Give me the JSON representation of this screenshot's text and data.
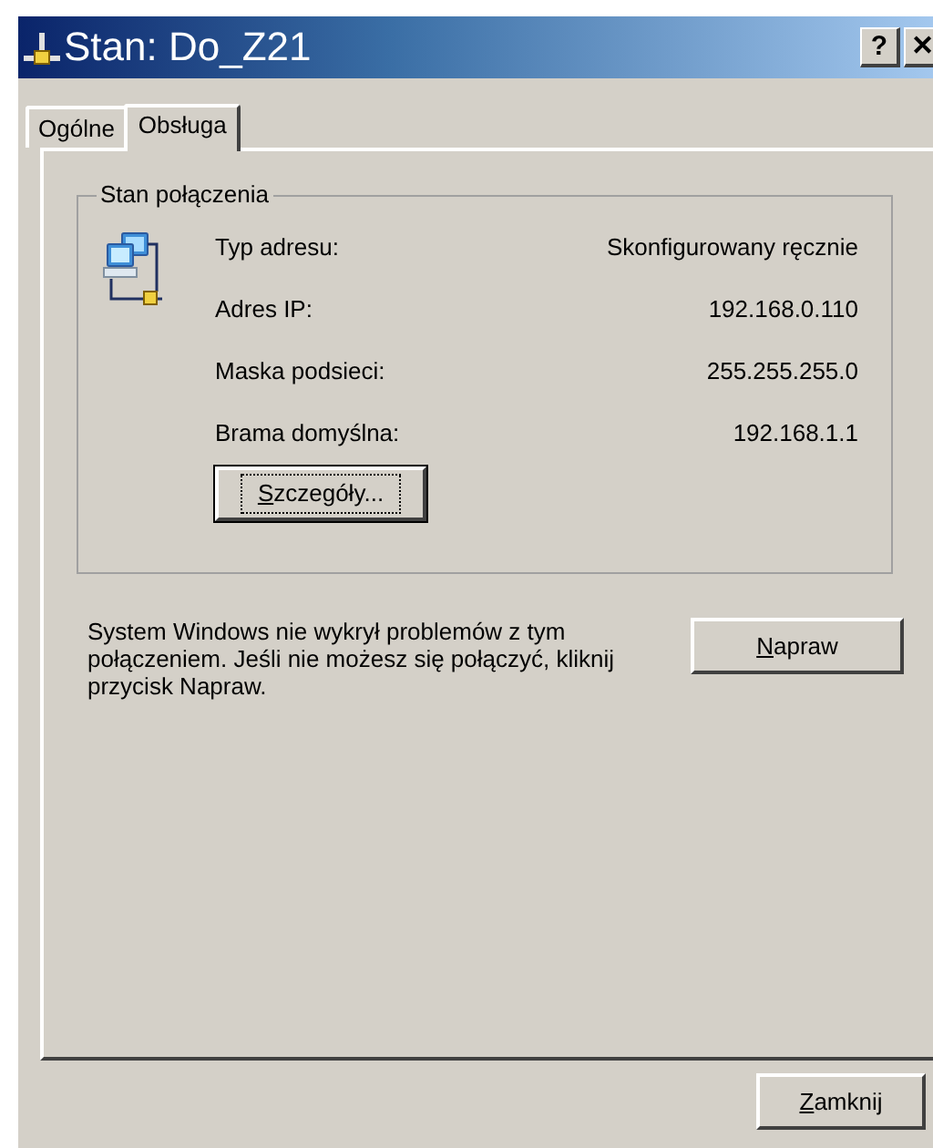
{
  "window": {
    "title": "Stan: Do_Z21",
    "buttons": [
      "?",
      "✕"
    ]
  },
  "tabs": [
    {
      "label": "Ogólne",
      "selected": false
    },
    {
      "label": "Obsługa",
      "selected": true
    }
  ],
  "group": {
    "title": "Stan połączenia",
    "rows": [
      {
        "label": "Typ adresu:",
        "value": "Skonfigurowany ręcznie"
      },
      {
        "label": "Adres IP:",
        "value": "192.168.0.110"
      },
      {
        "label": "Maska podsieci:",
        "value": "255.255.255.0"
      },
      {
        "label": "Brama domyślna:",
        "value": "192.168.1.1"
      }
    ],
    "button": {
      "label": "Szczegóły...",
      "focused": true
    }
  },
  "message": "System Windows nie wykrył problemów z tym połączeniem. Jeśli nie możesz się połączyć, kliknij przycisk Napraw.",
  "repair_button": {
    "label": "Napraw",
    "focused": false
  },
  "close_button": {
    "label": "Zamknij",
    "focused": false
  }
}
